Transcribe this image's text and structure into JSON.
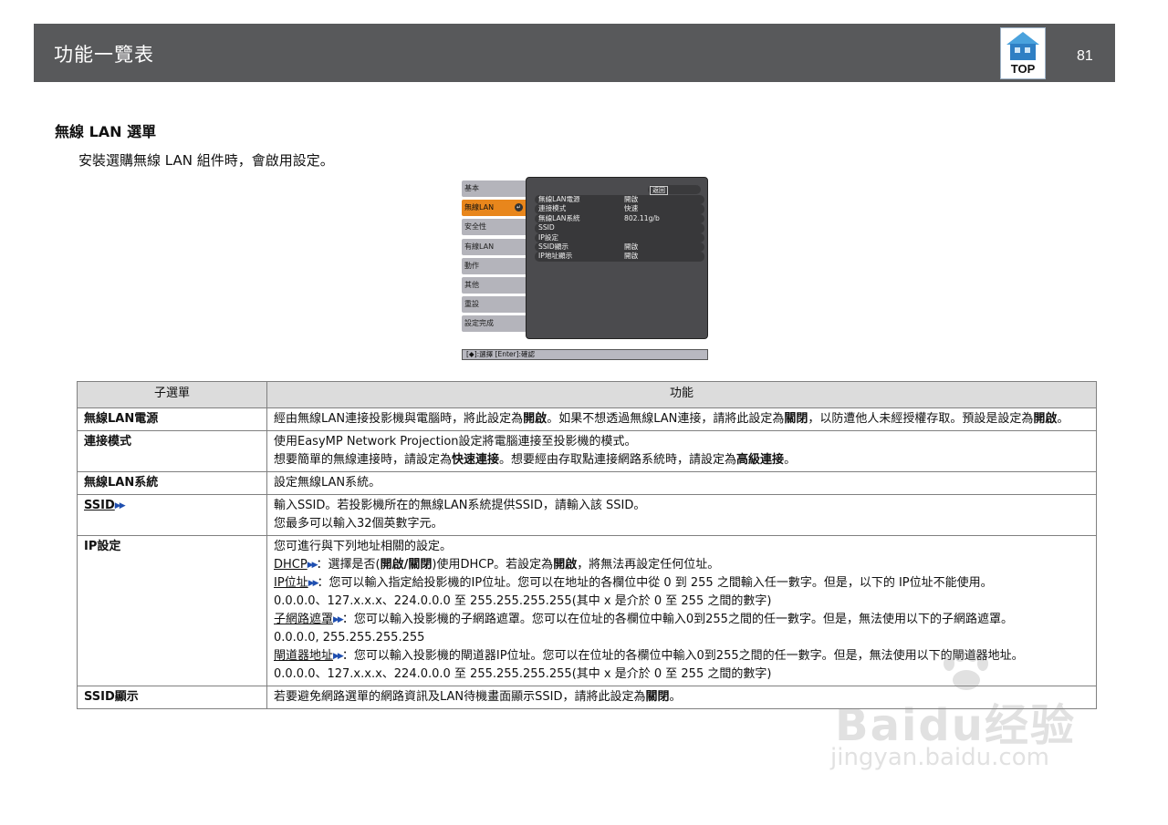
{
  "header": {
    "title": "功能一覽表",
    "top_label": "TOP",
    "page_number": "81"
  },
  "section": {
    "title": "無線 LAN 選單",
    "description": "安裝選購無線 LAN 組件時，會啟用設定。"
  },
  "menu_screenshot": {
    "left_items": [
      "基本",
      "無線LAN",
      "安全性",
      "有線LAN",
      "動作",
      "其他",
      "重設",
      "設定完成"
    ],
    "active_index": 1,
    "back_label": "返回",
    "rows": [
      {
        "k": "無線LAN電源",
        "v": "開啟"
      },
      {
        "k": "連接模式",
        "v": "快速"
      },
      {
        "k": "無線LAN系統",
        "v": "802.11g/b"
      },
      {
        "k": "SSID",
        "v": ""
      },
      {
        "k": "IP設定",
        "v": ""
      },
      {
        "k": "SSID顯示",
        "v": "開啟"
      },
      {
        "k": "IP地址顯示",
        "v": "開啟"
      }
    ],
    "footer": "[◆]:選擇 [Enter]:確認"
  },
  "table": {
    "headers": [
      "子選單",
      "功能"
    ],
    "r1": {
      "name": "無線LAN電源",
      "t1": "經由無線LAN連接投影機與電腦時，將此設定為",
      "b1": "開啟",
      "t2": "。如果不想透過無線LAN連接，請將此設定為",
      "b2": "關閉",
      "t3": "，以防遭他人未經授權存取。預設是設定為",
      "b3": "開啟",
      "t4": "。"
    },
    "r2": {
      "name": "連接模式",
      "line1": "使用EasyMP Network Projection設定將電腦連接至投影機的模式。",
      "t1": "想要簡單的無線連接時，請設定為",
      "b1": "快速連接",
      "t2": "。想要經由存取點連接網路系統時，請設定為",
      "b2": "高級連接",
      "t3": "。"
    },
    "r3": {
      "name": "無線LAN系統",
      "line1": "設定無線LAN系統。"
    },
    "r4": {
      "name": "SSID",
      "line1": "輸入SSID。若投影機所在的無線LAN系統提供SSID，請輸入該 SSID。",
      "line2": "您最多可以輸入32個英數字元。"
    },
    "r5": {
      "name": "IP設定",
      "intro": "您可進行與下列地址相關的設定。",
      "dhcp_link": "DHCP",
      "dhcp_t1": "：選擇是否(",
      "dhcp_b1": "開啟",
      "dhcp_sep": "/",
      "dhcp_b2": "關閉",
      "dhcp_t2": ")使用DHCP。若設定為",
      "dhcp_b3": "開啟",
      "dhcp_t3": "，將無法再設定任何位址。",
      "ip_link": "IP位址",
      "ip_text": "：您可以輸入指定給投影機的IP位址。您可以在地址的各欄位中從 0 到 255 之間輸入任一數字。但是，以下的 IP位址不能使用。",
      "ip_excl": "0.0.0.0、127.x.x.x、224.0.0.0 至 255.255.255.255(其中 x 是介於 0 至 255 之間的數字)",
      "mask_link": "子網路遮罩",
      "mask_text": "：您可以輸入投影機的子網路遮罩。您可以在位址的各欄位中輸入0到255之間的任一數字。但是，無法使用以下的子網路遮罩。",
      "mask_excl": "0.0.0.0, 255.255.255.255",
      "gw_link": "閘道器地址",
      "gw_text": "：您可以輸入投影機的閘道器IP位址。您可以在位址的各欄位中輸入0到255之間的任一數字。但是，無法使用以下的閘道器地址。",
      "gw_excl": "0.0.0.0、127.x.x.x、224.0.0.0 至 255.255.255.255(其中 x 是介於 0 至 255 之間的數字)"
    },
    "r6": {
      "name": "SSID顯示",
      "t1": "若要避免網路選單的網路資訊及LAN待機畫面顯示SSID，請將此設定為",
      "b1": "關閉",
      "t2": "。"
    },
    "link_arrow": "▶▶"
  },
  "watermark": {
    "big": "Baidu经验",
    "small": "jingyan.baidu.com"
  },
  "colors": {
    "header_bg": "#58595b",
    "table_header_bg": "#dcdcdc",
    "menu_active": "#e8861c",
    "link_arrow": "#1f4fb0"
  }
}
